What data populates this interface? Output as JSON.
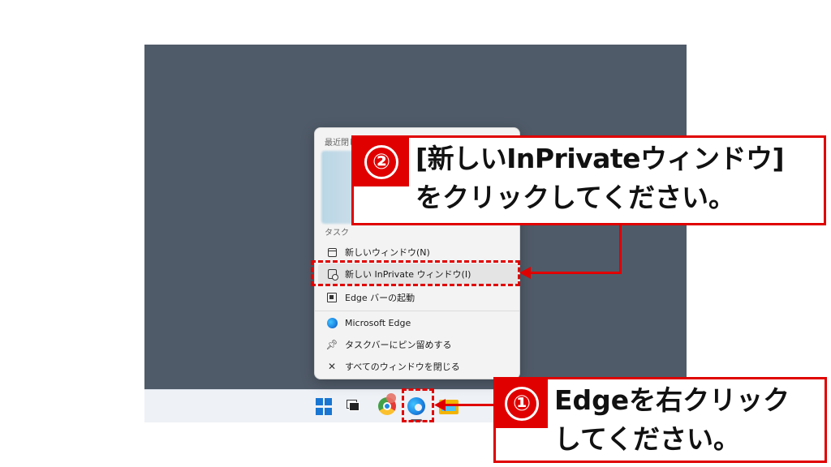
{
  "jumplist": {
    "recent_title": "最近閉じた項目",
    "tasks_title": "タスク",
    "items": [
      {
        "label": "新しいウィンドウ(N)",
        "icon": "window-icon"
      },
      {
        "label": "新しい InPrivate ウィンドウ(I)",
        "icon": "inprivate-window-icon"
      },
      {
        "label": "Edge バーの起動",
        "icon": "edge-bar-icon"
      },
      {
        "label": "Microsoft Edge",
        "icon": "edge-icon"
      },
      {
        "label": "タスクバーにピン留めする",
        "icon": "pin-icon"
      },
      {
        "label": "すべてのウィンドウを閉じる",
        "icon": "close-icon"
      }
    ]
  },
  "taskbar": {
    "icons": [
      "windows-start-icon",
      "task-view-icon",
      "chrome-icon",
      "edge-icon",
      "file-explorer-icon"
    ]
  },
  "callouts": {
    "step2": {
      "number": "②",
      "line1": "[新しいInPrivateウィンドウ]",
      "line2": "をクリックしてください。"
    },
    "step1": {
      "number": "①",
      "line1": "Edgeを右クリック",
      "line2": "してください。"
    }
  },
  "colors": {
    "accent": "#e00000",
    "desktop": "#505b69",
    "taskbar": "#eef1f6"
  }
}
